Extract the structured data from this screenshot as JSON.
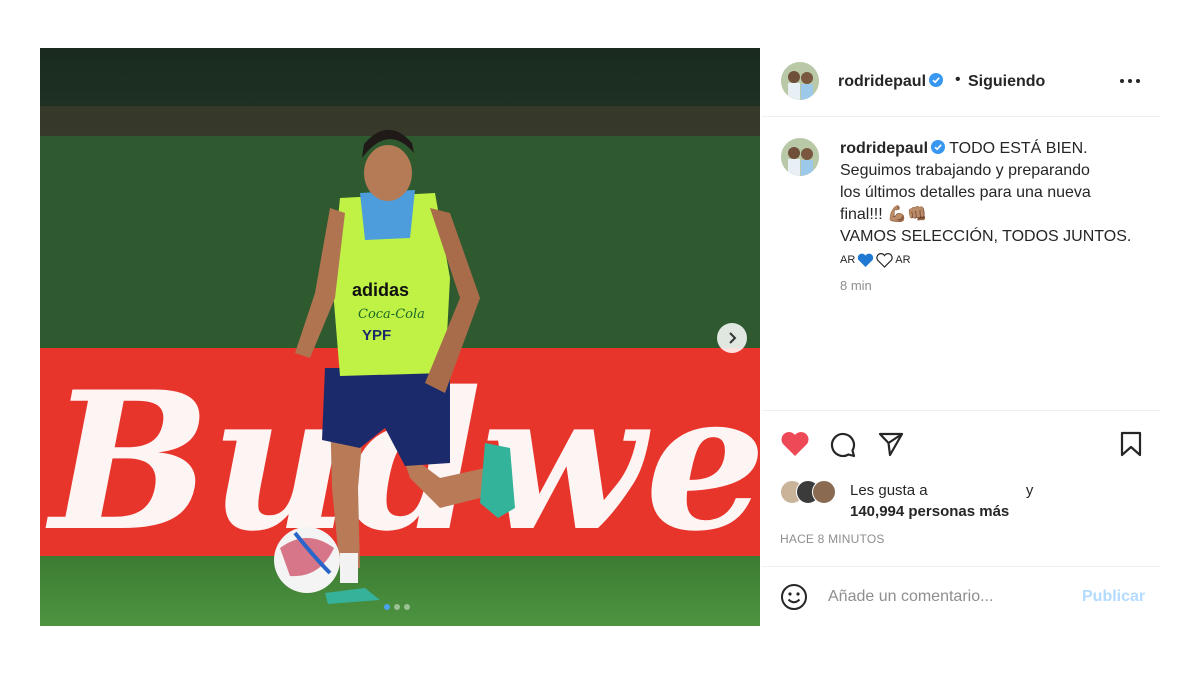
{
  "post": {
    "username": "rodridepaul",
    "separator": "•",
    "follow_status": "Siguiendo",
    "caption": {
      "line1": "TODO ESTÁ BIEN.",
      "line2": "Seguimos trabajando y preparando",
      "line3": "los últimos detalles para una nueva",
      "line4": "final!!! 💪🏽👊🏽",
      "line5": "VAMOS SELECCIÓN, TODOS JUNTOS.",
      "flag1": "AR",
      "flag2": "AR"
    },
    "caption_time": "8 min",
    "likes": {
      "prefix": "Les gusta a",
      "suffix": "y",
      "count": "140,994 personas más"
    },
    "timestamp": "HACE 8 MINUTOS",
    "comment": {
      "placeholder": "Añade un comentario...",
      "publish_label": "Publicar"
    },
    "carousel": {
      "current": 1,
      "total": 3
    },
    "image_sign_text": "Budwei"
  },
  "icons": {
    "verified": "verified-badge-icon",
    "more": "more-options-icon",
    "like": "heart-filled-icon",
    "comment": "comment-icon",
    "share": "share-icon",
    "save": "bookmark-icon",
    "emoji": "smiley-icon",
    "next": "chevron-right-icon"
  },
  "colors": {
    "like_red": "#ed4956",
    "verified_blue": "#3897f0",
    "publish_disabled": "#b3dbff",
    "sign_red": "#e8352c"
  }
}
